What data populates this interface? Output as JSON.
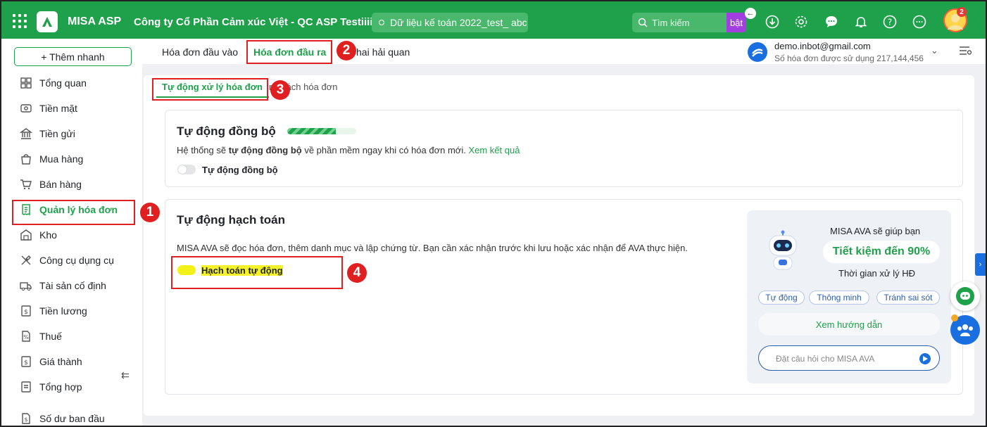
{
  "topbar": {
    "app_name": "MISA ASP",
    "company": "Công ty Cổ Phần Cảm xúc Việt - QC ASP Testiiii",
    "database": "Dữ liệu kế toán 2022_test_ abc",
    "search_placeholder": "Tìm kiếm",
    "search_tag": "bật",
    "notification_count": "2",
    "accent": "#1fa04a"
  },
  "sidebar": {
    "quick_add": "+ Thêm nhanh",
    "items": [
      {
        "label": "Tổng quan",
        "icon": "dashboard-icon"
      },
      {
        "label": "Tiền mặt",
        "icon": "cash-icon"
      },
      {
        "label": "Tiền gửi",
        "icon": "bank-icon"
      },
      {
        "label": "Mua hàng",
        "icon": "shopping-bag-icon"
      },
      {
        "label": "Bán hàng",
        "icon": "cart-icon"
      },
      {
        "label": "Quản lý hóa đơn",
        "icon": "invoice-icon"
      },
      {
        "label": "Kho",
        "icon": "warehouse-icon"
      },
      {
        "label": "Công cụ dụng cụ",
        "icon": "tools-icon"
      },
      {
        "label": "Tài sản cố định",
        "icon": "truck-icon"
      },
      {
        "label": "Tiền lương",
        "icon": "salary-icon"
      },
      {
        "label": "Thuế",
        "icon": "tax-icon"
      },
      {
        "label": "Giá thành",
        "icon": "cost-icon"
      },
      {
        "label": "Tổng hợp",
        "icon": "summary-icon"
      },
      {
        "label": "Số dư ban đầu",
        "icon": "opening-balance-icon"
      }
    ],
    "active_index": 5
  },
  "main_tabs": [
    "Hóa đơn đầu vào",
    "Hóa đơn đầu ra",
    "hai hải quan"
  ],
  "account": {
    "email": "demo.inbot@gmail.com",
    "invoice_usage": "Số hóa đơn được sử dụng 217,144,456"
  },
  "sub_tabs": [
    "Tự động xử lý hóa đơn",
    "nh sách hóa đơn"
  ],
  "sync_card": {
    "title": "Tự động đồng bộ",
    "desc_prefix": "Hệ thống sẽ ",
    "desc_bold": "tự động đồng bộ",
    "desc_suffix": " về phần mềm ngay khi có hóa đơn mới. ",
    "link": "Xem kết quả",
    "toggle_label": "Tự động đồng bộ"
  },
  "accounting_card": {
    "title": "Tự động hạch toán",
    "desc": "MISA AVA sẽ đọc hóa đơn, thêm danh mục và lập chứng từ. Bạn cần xác nhận trước khi lưu hoặc xác nhận để AVA thực hiện.",
    "toggle_label": "Hạch toán tự động"
  },
  "ava": {
    "line1": "MISA AVA sẽ giúp bạn",
    "highlight": "Tiết kiệm đến 90%",
    "line3": "Thời gian xử lý HĐ",
    "tags": [
      "Tự động",
      "Thông minh",
      "Tránh sai sót"
    ],
    "guide": "Xem hướng dẫn",
    "ask_placeholder": "Đặt câu hỏi cho MISA AVA"
  },
  "annotations": [
    "1",
    "2",
    "3",
    "4"
  ]
}
